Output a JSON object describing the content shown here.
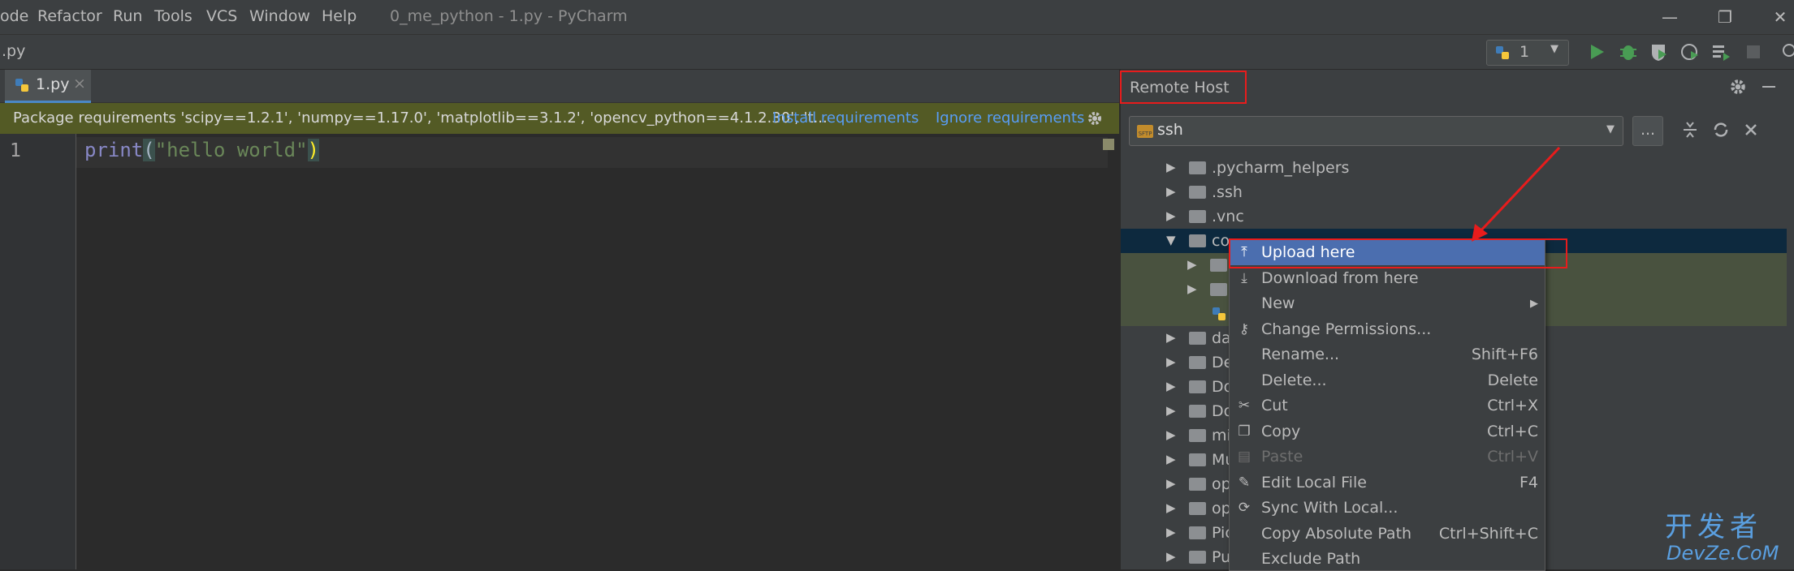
{
  "menubar": {
    "items": [
      "ode",
      "Refactor",
      "Run",
      "Tools",
      "VCS",
      "Window",
      "Help"
    ],
    "window_title": "0_me_python - 1.py - PyCharm",
    "minimize": "—",
    "restore": "❐",
    "close": "✕"
  },
  "navbar": {
    "breadcrumb": ".py",
    "run_config": "1"
  },
  "editor": {
    "tab_label": "1.py",
    "tab_close": "×",
    "banner": {
      "text": "Package requirements 'scipy==1.2.1', 'numpy==1.17.0', 'matplotlib==3.1.2', 'opencv_python==4.1.2.30', 't...",
      "install": "Install requirements",
      "ignore": "Ignore requirements"
    },
    "line_number": "1",
    "code": {
      "keyword": "print",
      "open_paren": "(",
      "string": "\"hello world\"",
      "close_paren": ")"
    }
  },
  "remote_host": {
    "title": "Remote Host",
    "selected_host": "ssh",
    "browse": "...",
    "tree": [
      {
        "label": ".pycharm_helpers",
        "expanded": false
      },
      {
        "label": ".ssh",
        "expanded": false
      },
      {
        "label": ".vnc",
        "expanded": false
      },
      {
        "label": "co",
        "expanded": true,
        "selected": true
      },
      {
        "label": "",
        "expanded": false,
        "child": true
      },
      {
        "label": "",
        "expanded": false,
        "child": true
      },
      {
        "label": "",
        "file": true
      },
      {
        "label": "da",
        "expanded": false
      },
      {
        "label": "De",
        "expanded": false
      },
      {
        "label": "Do",
        "expanded": false
      },
      {
        "label": "Do",
        "expanded": false
      },
      {
        "label": "mi",
        "expanded": false
      },
      {
        "label": "Mu",
        "expanded": false
      },
      {
        "label": "op",
        "expanded": false
      },
      {
        "label": "op",
        "expanded": false
      },
      {
        "label": "Pic",
        "expanded": false
      },
      {
        "label": "Pu",
        "expanded": false
      }
    ]
  },
  "context_menu": {
    "items": [
      {
        "label": "Upload here",
        "shortcut": "",
        "icon": "upload-icon",
        "highlighted": true
      },
      {
        "label": "Download from here",
        "shortcut": "",
        "icon": "download-icon"
      },
      {
        "label": "New",
        "shortcut": "▶",
        "icon": ""
      },
      {
        "label": "Change Permissions...",
        "shortcut": "",
        "icon": "key-icon"
      },
      {
        "label": "Rename...",
        "shortcut": "Shift+F6",
        "icon": ""
      },
      {
        "label": "Delete...",
        "shortcut": "Delete",
        "icon": ""
      },
      {
        "label": "Cut",
        "shortcut": "Ctrl+X",
        "icon": "scissors-icon"
      },
      {
        "label": "Copy",
        "shortcut": "Ctrl+C",
        "icon": "copy-icon"
      },
      {
        "label": "Paste",
        "shortcut": "Ctrl+V",
        "icon": "paste-icon",
        "disabled": true
      },
      {
        "label": "Edit Local File",
        "shortcut": "F4",
        "icon": "edit-icon"
      },
      {
        "label": "Sync With Local...",
        "shortcut": "",
        "icon": "sync-icon"
      },
      {
        "label": "Copy Absolute Path",
        "shortcut": "Ctrl+Shift+C",
        "icon": ""
      },
      {
        "label": "Exclude Path",
        "shortcut": "",
        "icon": ""
      }
    ]
  },
  "watermark": {
    "line1": "开发者",
    "line2": "DevZe.CoM"
  },
  "colors": {
    "accent": "#4b6eaf",
    "annotation": "#e81c1c",
    "banner_bg": "#535a25",
    "link": "#589df6"
  }
}
